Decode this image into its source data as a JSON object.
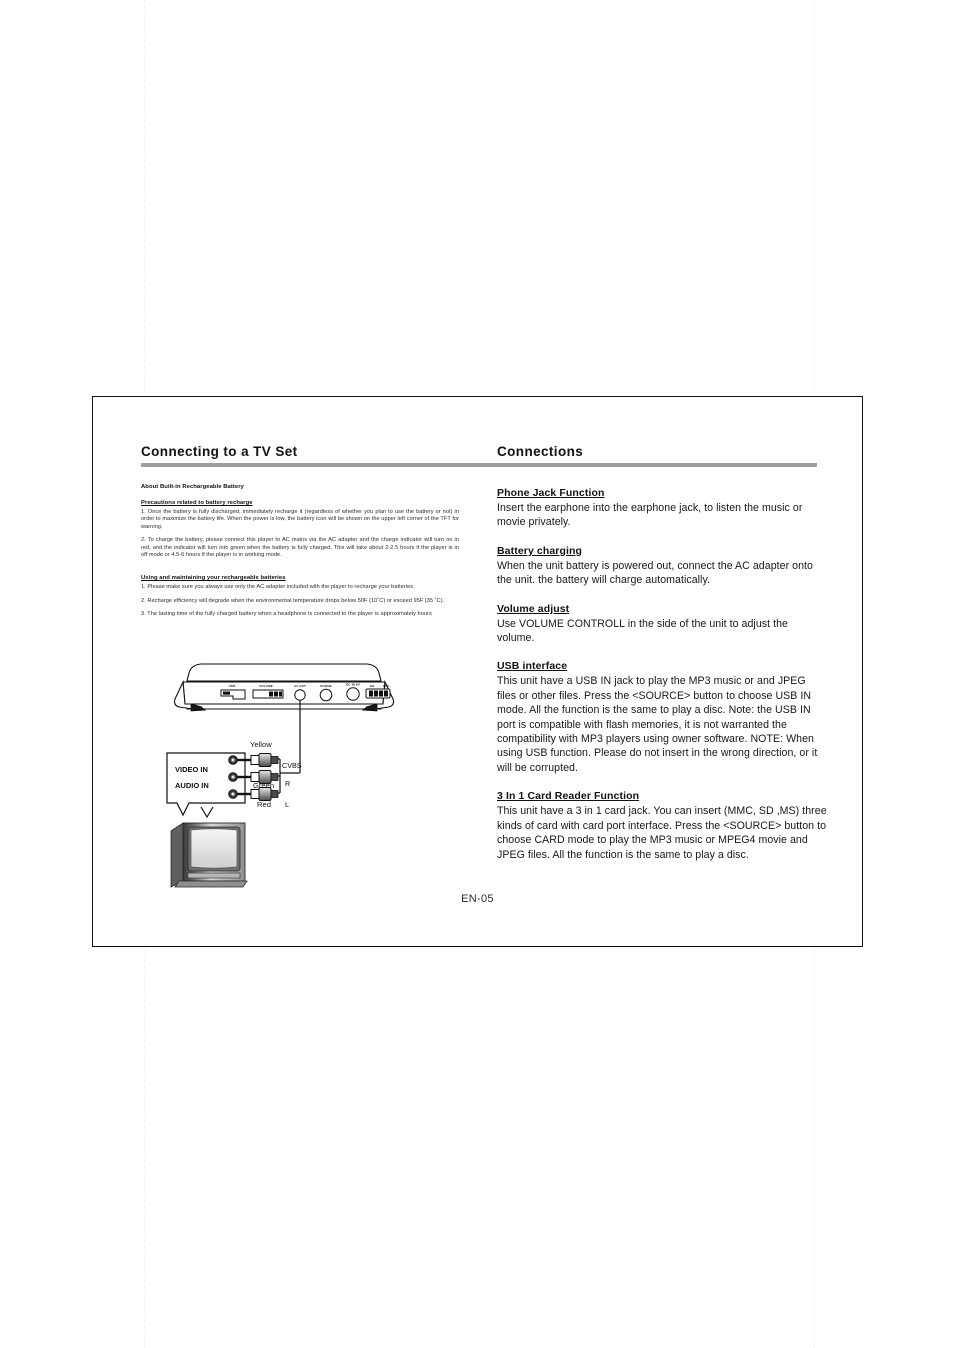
{
  "page": {
    "footer_label": "EN-05"
  },
  "header": {
    "left_title": "Connecting to a TV Set",
    "right_title": "Connections"
  },
  "left_column": {
    "battery_section": {
      "heading": "About Built-in Rechargeable Battery",
      "subheading": "Precautions related to battery recharge",
      "paragraph_1": "1. Once the battery is fully discharged, immediately recharge it (regardless of whether you plan to use the battery or not) in order to maximize the battery life. When the power is low, the battery icon will be shown on the upper left corner of the TFT for warning.",
      "paragraph_2": "2. To charge the battery, please connect this player to AC mains via the AC adapter and the charge indicator will turn on in red, and the indicator will turn into green when the battery is fully charged. This will take about 2-2.5 hours if the player is in off mode or 4.5-6 hours if the player is in working mode."
    },
    "maintaining_section": {
      "heading": "Using and maintaining your rechargeable batteries",
      "paragraph_1": "1. Please make sure you always use only the AC adapter included with the player to recharge your batteries.",
      "paragraph_2": "2. Recharge efficiency will degrade when the environmental temperature drops below 50F (10˚C) or exceed 95F (35 ˚C).",
      "paragraph_3": "3. The lasting time of the fully charged battery when a headphone is connected to the player is approximately        hours"
    }
  },
  "right_column": {
    "sections": [
      {
        "heading": "Phone Jack Function",
        "body": "Insert the earphone into the earphone jack, to listen the music or movie privately."
      },
      {
        "heading": "Battery charging",
        "body": "When the unit battery is powered out, connect the AC adapter onto the unit. the battery will charge automatically."
      },
      {
        "heading": "Volume adjust",
        "body": "Use VOLUME CONTROLL in the side of the unit to adjust the volume."
      },
      {
        "heading": "USB interface",
        "body": "This unit have a USB IN jack  to play the MP3 music or and JPEG files or other files. Press the <SOURCE> button to choose USB IN mode. All the function is the same to play a disc. Note: the USB IN port is compatible with flash memories, it is not warranted the compatibility with MP3 players using owner software. NOTE: When using USB function. Please do not insert in the wrong direction, or it will be corrupted."
      },
      {
        "heading": "3 In 1 Card  Reader Function",
        "body": "This unit have a 3 in 1 card jack. You can  insert (MMC, SD ,MS) three kinds of card with card port interface. Press the <SOURCE> button to choose CARD mode to play the MP3 music or MPEG4 movie and JPEG files. All the function is the same to play a disc."
      }
    ]
  },
  "diagram": {
    "unit_panel_labels": [
      "USB",
      "VOLUME",
      "AV OUT",
      "PHONE",
      "DC IN 9V",
      "ON",
      "OFF"
    ],
    "tv_jack_labels": [
      "VIDEO IN",
      "AUDIO IN"
    ],
    "plug_color_labels": [
      "Yellow",
      "Green",
      "Red"
    ],
    "signal_labels": [
      "CVBS",
      "R",
      "L"
    ]
  },
  "colors": {
    "rule": "#9e9c9c",
    "frame": "#14100f",
    "text": "#141414"
  }
}
